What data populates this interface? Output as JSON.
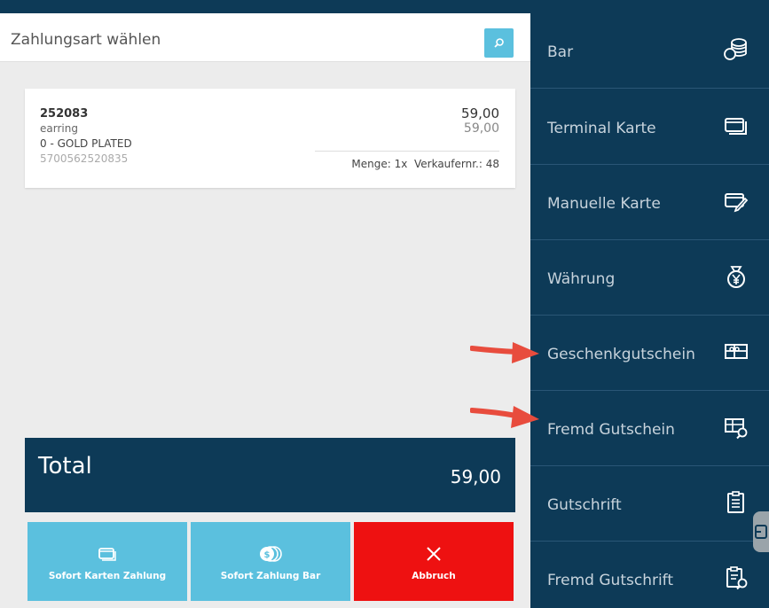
{
  "search": {
    "placeholder": "Zahlungsart wählen"
  },
  "item": {
    "code": "252083",
    "name": "earring",
    "variant": "0 - GOLD PLATED",
    "ean": "5700562520835",
    "price": "59,00",
    "price_total": "59,00",
    "meta": "Menge: 1x  Verkaufernr.: 48"
  },
  "total": {
    "label": "Total",
    "value": "59,00"
  },
  "actions": [
    {
      "label": "Sofort Karten Zahlung",
      "icon": "card-icon"
    },
    {
      "label": "Sofort Zahlung Bar",
      "icon": "coin-icon"
    },
    {
      "label": "Abbruch",
      "icon": "close-icon"
    }
  ],
  "payment_methods": [
    {
      "label": "Bar",
      "icon": "coins-stack-icon"
    },
    {
      "label": "Terminal Karte",
      "icon": "card-icon"
    },
    {
      "label": "Manuelle Karte",
      "icon": "card-edit-icon"
    },
    {
      "label": "Währung",
      "icon": "money-bag-yen-icon"
    },
    {
      "label": "Geschenkgutschein",
      "icon": "gift-voucher-icon"
    },
    {
      "label": "Fremd Gutschein",
      "icon": "voucher-search-icon"
    },
    {
      "label": "Gutschrift",
      "icon": "clipboard-icon"
    },
    {
      "label": "Fremd Gutschrift",
      "icon": "clipboard-search-icon"
    }
  ],
  "colors": {
    "navy": "#0d3a57",
    "cyan": "#5bc0de",
    "red": "#ee1111",
    "arrow": "#e84c3d"
  }
}
